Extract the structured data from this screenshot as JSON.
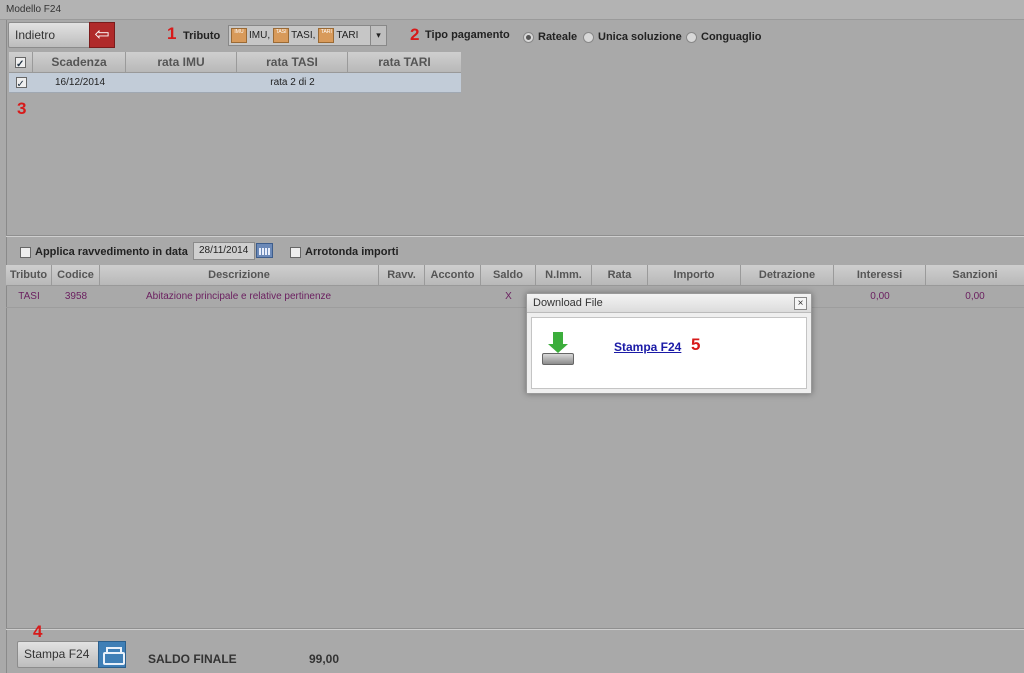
{
  "window": {
    "title": "Modello F24"
  },
  "toolbar": {
    "back_label": "Indietro",
    "tributo_label": "Tributo",
    "tipo_pagamento_label": "Tipo pagamento"
  },
  "steps": [
    "1",
    "2",
    "3",
    "4",
    "5"
  ],
  "tributo_select": {
    "items": [
      {
        "tag": "IMU",
        "label": "IMU,"
      },
      {
        "tag": "TASI",
        "label": "TASI,"
      },
      {
        "tag": "TARI",
        "label": "TARI"
      }
    ]
  },
  "payment_options": [
    {
      "label": "Rateale",
      "selected": true
    },
    {
      "label": "Unica soluzione",
      "selected": false
    },
    {
      "label": "Conguaglio",
      "selected": false
    }
  ],
  "installments": {
    "headers": [
      "Scadenza",
      "rata IMU",
      "rata TASI",
      "rata TARI"
    ],
    "rows": [
      {
        "checked": true,
        "scadenza": "16/12/2014",
        "rata_imu": "",
        "rata_tasi": "rata 2 di 2",
        "rata_tari": ""
      }
    ]
  },
  "options": {
    "ravvedimento_label": "Applica ravvedimento in data",
    "ravvedimento_date": "28/11/2014",
    "arrotonda_label": "Arrotonda importi"
  },
  "details": {
    "headers": [
      "Tributo",
      "Codice",
      "Descrizione",
      "Ravv.",
      "Acconto",
      "Saldo",
      "N.Imm.",
      "Rata",
      "Importo",
      "Detrazione",
      "Interessi",
      "Sanzioni"
    ],
    "rows": [
      {
        "tributo": "TASI",
        "codice": "3958",
        "descrizione": "Abitazione principale e relative pertinenze",
        "ravv": "",
        "acconto": "",
        "saldo": "X",
        "nimm": "",
        "rata": "",
        "importo": "",
        "detrazione": "",
        "interessi": "0,00",
        "sanzioni": "0,00"
      }
    ]
  },
  "download_dialog": {
    "title": "Download File",
    "link_label": "Stampa F24"
  },
  "footer": {
    "stampa_label": "Stampa F24",
    "saldo_label": "SALDO FINALE",
    "saldo_value": "99,00"
  },
  "colors": {
    "accent_red": "#d71a1a",
    "back_icon": "#b02a2a",
    "print_icon": "#3f7fb6",
    "row_selected": "#c2ccd8"
  }
}
